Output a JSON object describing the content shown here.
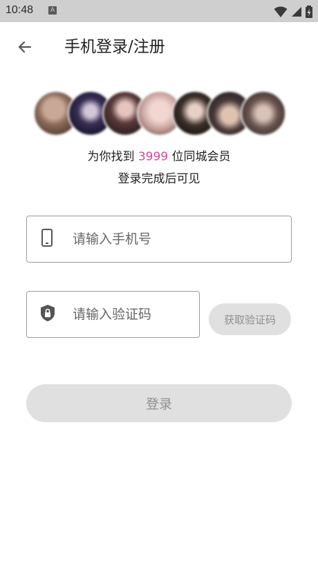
{
  "status_bar": {
    "time": "10:48",
    "notification_letter": "A",
    "icons": [
      "wifi-icon",
      "signal-icon",
      "battery-charging-icon"
    ]
  },
  "header": {
    "back_icon": "arrow-left-icon",
    "title": "手机登录/注册"
  },
  "avatars": {
    "count_shown": 7,
    "colors": [
      "#8b6a5a",
      "#2a2340",
      "#3a2c2c",
      "#c9a5a0",
      "#2c2420",
      "#4a3a3a",
      "#6a5650"
    ]
  },
  "info": {
    "line1_prefix": "为你找到 ",
    "count": "3999",
    "line1_suffix": " 位同城会员",
    "line2": "登录完成后可见",
    "count_color": "#e0459b"
  },
  "phone_input": {
    "placeholder": "请输入手机号",
    "value": "",
    "icon": "phone-icon"
  },
  "code_input": {
    "placeholder": "请输入验证码",
    "value": "",
    "icon": "shield-lock-icon"
  },
  "get_code_button": {
    "label": "获取验证码"
  },
  "login_button": {
    "label": "登录"
  }
}
